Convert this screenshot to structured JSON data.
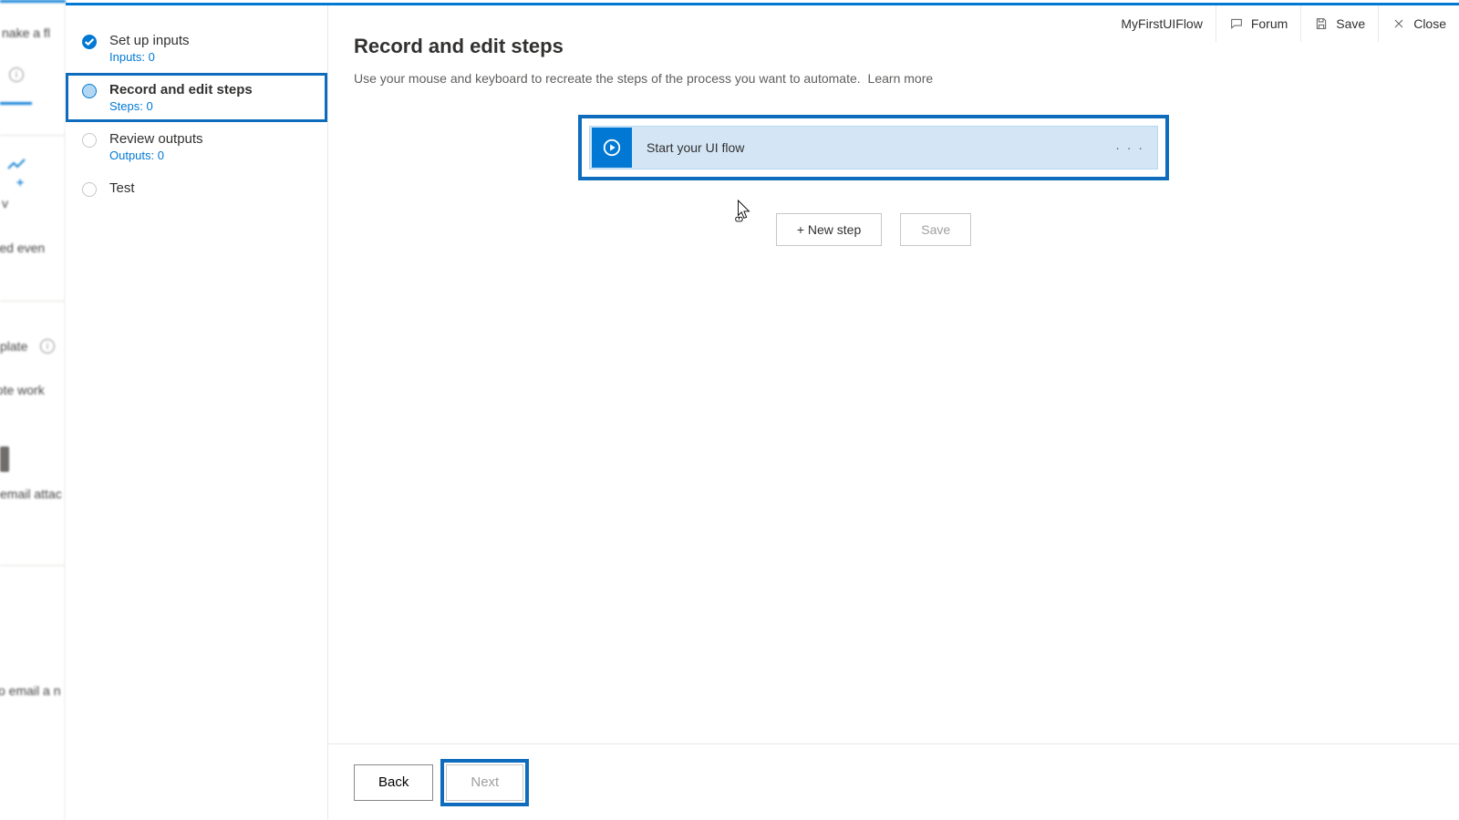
{
  "background": {
    "heading_fragment": "nake a fl",
    "trigger_fragment": "signated even",
    "template_fragment": "plate",
    "remote_fragment": "note work",
    "attach_fragment": "email attac",
    "email_fragment": "o email a n",
    "flow_label_fragment": "v"
  },
  "header": {
    "title": "MyFirstUIFlow",
    "forum": "Forum",
    "save": "Save",
    "close": "Close"
  },
  "steps": [
    {
      "t1": "Set up inputs",
      "t2": "Inputs: 0",
      "state": "done"
    },
    {
      "t1": "Record and edit steps",
      "t2": "Steps: 0",
      "state": "active"
    },
    {
      "t1": "Review outputs",
      "t2": "Outputs: 0",
      "state": "pending"
    },
    {
      "t1": "Test",
      "t2": "",
      "state": "pending"
    }
  ],
  "main": {
    "title": "Record and edit steps",
    "subtitle": "Use your mouse and keyboard to recreate the steps of the process you want to automate.",
    "learn_more": "Learn more"
  },
  "flow_card": {
    "title": "Start your UI flow"
  },
  "actions": {
    "new_step": "+ New step",
    "save": "Save"
  },
  "footer": {
    "back": "Back",
    "next": "Next"
  }
}
